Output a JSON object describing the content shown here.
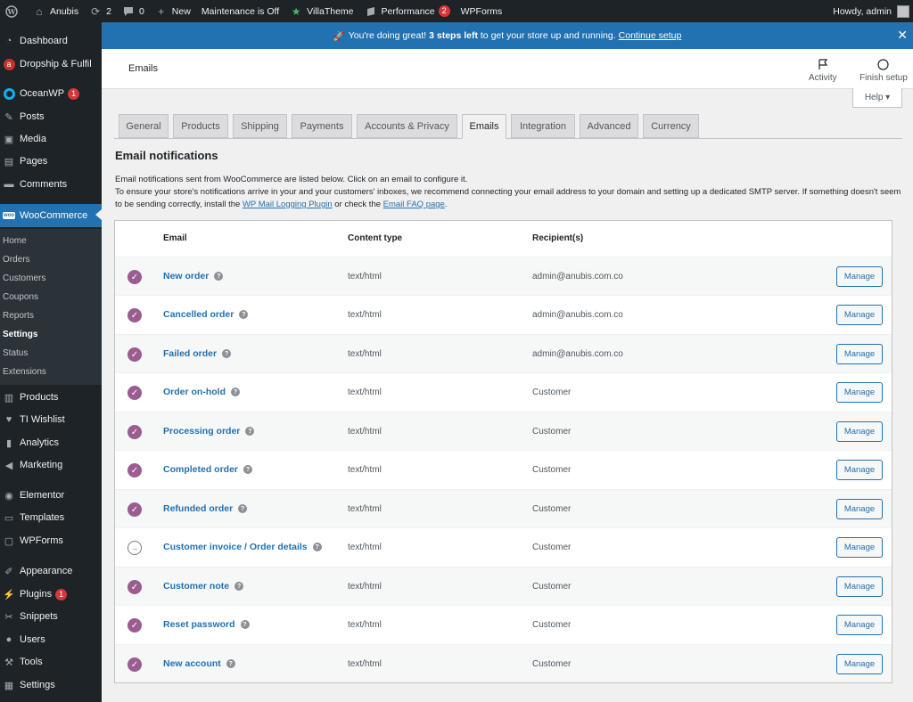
{
  "adminbar": {
    "site_name": "Anubis",
    "updates_count": "2",
    "comments_count": "0",
    "new_label": "New",
    "maintenance_label": "Maintenance is Off",
    "villatheme_label": "VillaTheme",
    "performance_label": "Performance",
    "performance_badge": "2",
    "wpforms_label": "WPForms",
    "howdy": "Howdy, admin"
  },
  "sidebar": {
    "items": [
      {
        "label": "Dashboard",
        "icon": "dashboard-icon"
      },
      {
        "label": "Dropship & Fulfil",
        "icon": "dropship-icon"
      },
      {
        "label": "OceanWP",
        "icon": "oceanwp-icon",
        "badge": "1"
      },
      {
        "label": "Posts",
        "icon": "pin-icon"
      },
      {
        "label": "Media",
        "icon": "media-icon"
      },
      {
        "label": "Pages",
        "icon": "pages-icon"
      },
      {
        "label": "Comments",
        "icon": "comment-icon"
      },
      {
        "label": "WooCommerce",
        "icon": "woo-icon"
      },
      {
        "label": "Products",
        "icon": "products-icon"
      },
      {
        "label": "TI Wishlist",
        "icon": "heart-icon"
      },
      {
        "label": "Analytics",
        "icon": "analytics-icon"
      },
      {
        "label": "Marketing",
        "icon": "megaphone-icon"
      },
      {
        "label": "Elementor",
        "icon": "elementor-icon"
      },
      {
        "label": "Templates",
        "icon": "folder-icon"
      },
      {
        "label": "WPForms",
        "icon": "forms-icon"
      },
      {
        "label": "Appearance",
        "icon": "brush-icon"
      },
      {
        "label": "Plugins",
        "icon": "plug-icon",
        "badge": "1"
      },
      {
        "label": "Snippets",
        "icon": "scissors-icon"
      },
      {
        "label": "Users",
        "icon": "user-icon"
      },
      {
        "label": "Tools",
        "icon": "wrench-icon"
      },
      {
        "label": "Settings",
        "icon": "settings-icon"
      }
    ],
    "woo_sub": [
      "Home",
      "Orders",
      "Customers",
      "Coupons",
      "Reports",
      "Settings",
      "Status",
      "Extensions"
    ]
  },
  "notice": {
    "emoji": "🚀",
    "text_before": "You're doing great!",
    "bold": "3 steps left",
    "text_after": "to get your store up and running.",
    "link": "Continue setup"
  },
  "header": {
    "title": "Emails",
    "activity": "Activity",
    "finish_setup": "Finish setup",
    "help": "Help ▾"
  },
  "tabs": [
    "General",
    "Products",
    "Shipping",
    "Payments",
    "Accounts & Privacy",
    "Emails",
    "Integration",
    "Advanced",
    "Currency"
  ],
  "active_tab": "Emails",
  "section": {
    "title": "Email notifications",
    "line1": "Email notifications sent from WooCommerce are listed below. Click on an email to configure it.",
    "line2_a": "To ensure your store's notifications arrive in your and your customers' inboxes, we recommend connecting your email address to your domain and setting up a dedicated SMTP server. If something doesn't seem to be sending correctly, install the",
    "link1": "WP Mail Logging Plugin",
    "line2_b": "or check the",
    "link2": "Email FAQ page",
    "line2_c": "."
  },
  "table": {
    "headers": {
      "email": "Email",
      "content_type": "Content type",
      "recipients": "Recipient(s)"
    },
    "manage_label": "Manage",
    "rows": [
      {
        "name": "New order",
        "content_type": "text/html",
        "recipient": "admin@anubis.com.co",
        "status": "enabled"
      },
      {
        "name": "Cancelled order",
        "content_type": "text/html",
        "recipient": "admin@anubis.com.co",
        "status": "enabled"
      },
      {
        "name": "Failed order",
        "content_type": "text/html",
        "recipient": "admin@anubis.com.co",
        "status": "enabled"
      },
      {
        "name": "Order on-hold",
        "content_type": "text/html",
        "recipient": "Customer",
        "status": "enabled"
      },
      {
        "name": "Processing order",
        "content_type": "text/html",
        "recipient": "Customer",
        "status": "enabled"
      },
      {
        "name": "Completed order",
        "content_type": "text/html",
        "recipient": "Customer",
        "status": "enabled"
      },
      {
        "name": "Refunded order",
        "content_type": "text/html",
        "recipient": "Customer",
        "status": "enabled"
      },
      {
        "name": "Customer invoice / Order details",
        "content_type": "text/html",
        "recipient": "Customer",
        "status": "manual"
      },
      {
        "name": "Customer note",
        "content_type": "text/html",
        "recipient": "Customer",
        "status": "enabled"
      },
      {
        "name": "Reset password",
        "content_type": "text/html",
        "recipient": "Customer",
        "status": "enabled"
      },
      {
        "name": "New account",
        "content_type": "text/html",
        "recipient": "Customer",
        "status": "enabled"
      }
    ]
  },
  "colors": {
    "accent": "#2271b1",
    "woo_purple": "#9b5c8f",
    "adminbar": "#1d2327"
  }
}
